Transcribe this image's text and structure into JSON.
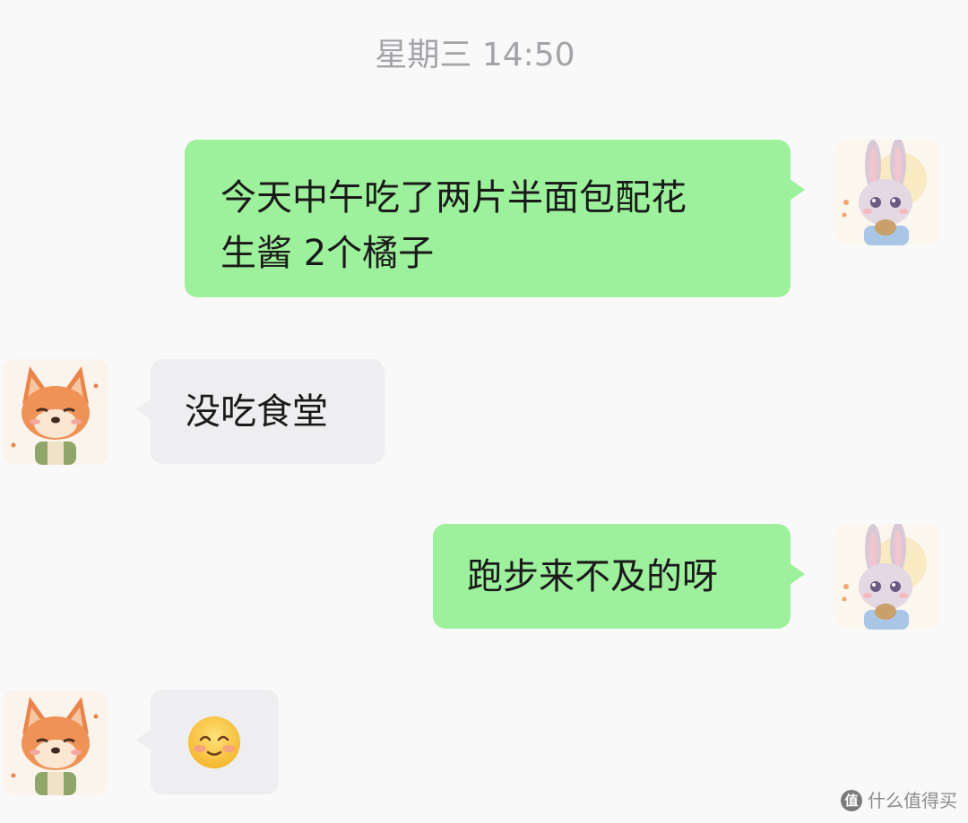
{
  "chat": {
    "timestamp": "星期三 14:50",
    "messages": [
      {
        "sender": "self",
        "avatar": "bunny-avatar",
        "text_line1": "今天中午吃了两片半面包配花",
        "text_line2": "生酱 2个橘子"
      },
      {
        "sender": "other",
        "avatar": "fox-avatar",
        "text": "没吃食堂"
      },
      {
        "sender": "self",
        "avatar": "bunny-avatar",
        "text": "跑步来不及的呀"
      },
      {
        "sender": "other",
        "avatar": "fox-avatar",
        "emoji": "blushing-smile-emoji"
      }
    ]
  },
  "colors": {
    "background": "#f9f9fa",
    "outgoing_bubble": "#9ef19c",
    "incoming_bubble": "#eeeef1",
    "timestamp_text": "#a3a3a8"
  },
  "watermark": {
    "icon_glyph": "值",
    "text": "什么值得买"
  }
}
